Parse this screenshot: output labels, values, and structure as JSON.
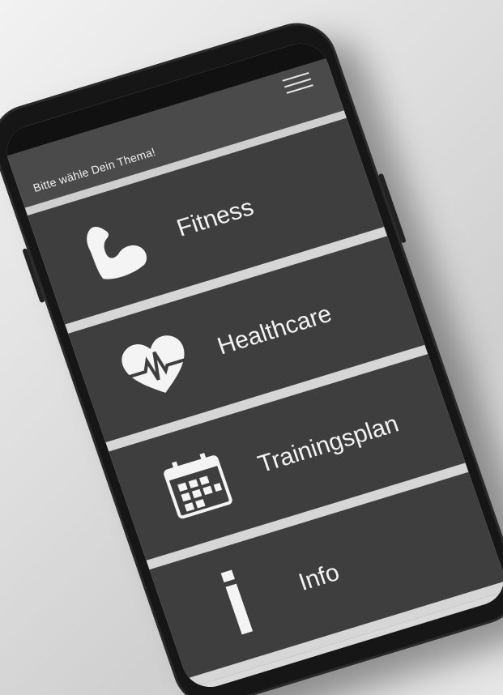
{
  "header": {
    "prompt": "Bitte wähle Dein Thema!",
    "menu_icon": "hamburger-menu-icon"
  },
  "menu": {
    "items": [
      {
        "label": "Fitness",
        "icon": "flexed-biceps-icon"
      },
      {
        "label": "Healthcare",
        "icon": "heart-pulse-icon"
      },
      {
        "label": "Trainingsplan",
        "icon": "calendar-icon"
      },
      {
        "label": "Info",
        "icon": "info-icon"
      }
    ]
  },
  "colors": {
    "tile": "#3e3e3e",
    "separator": "#d6d6d6",
    "text": "#f2f2f2",
    "phone_body": "#161616"
  }
}
